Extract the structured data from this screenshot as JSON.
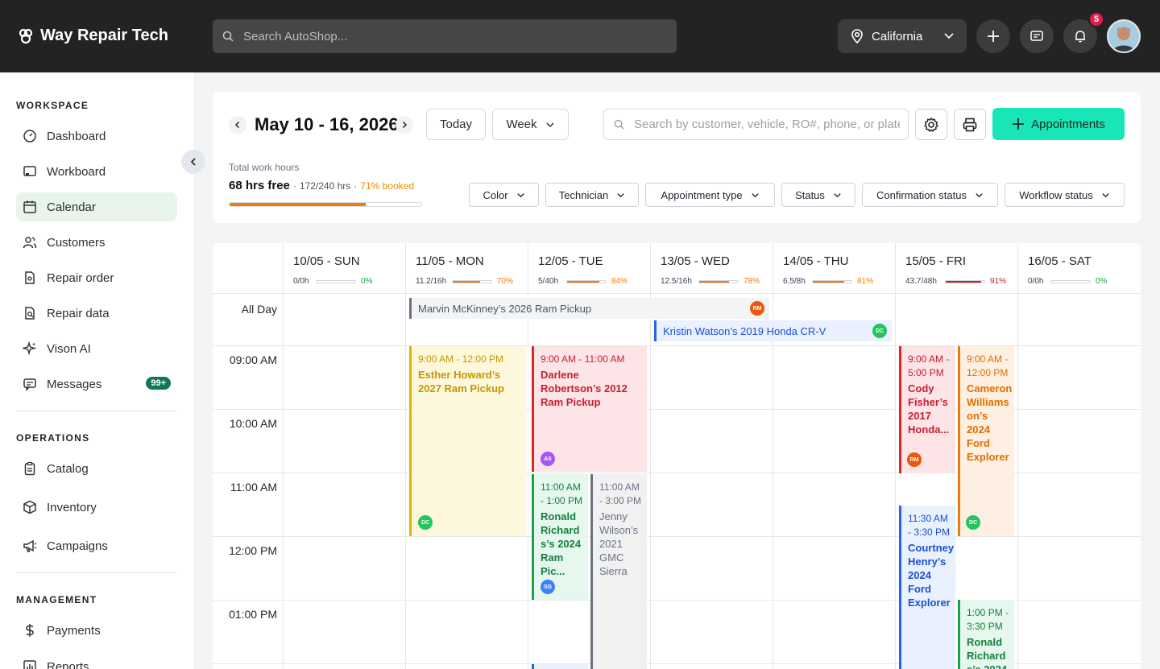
{
  "app": {
    "name": "Way Repair Tech"
  },
  "topbar": {
    "search_placeholder": "Search AutoShop...",
    "location": "California",
    "notification_count": "5"
  },
  "sidebar": {
    "workspace_title": "WORKSPACE",
    "workspace": [
      {
        "label": "Dashboard",
        "icon": "gauge-icon"
      },
      {
        "label": "Workboard",
        "icon": "board-icon"
      },
      {
        "label": "Calendar",
        "icon": "calendar-icon",
        "active": true
      },
      {
        "label": "Customers",
        "icon": "users-icon"
      },
      {
        "label": "Repair order",
        "icon": "document-icon"
      },
      {
        "label": "Repair data",
        "icon": "file-search-icon"
      },
      {
        "label": "Vison AI",
        "icon": "sparkle-icon"
      },
      {
        "label": "Messages",
        "icon": "message-icon",
        "count": "99+"
      }
    ],
    "operations_title": "OPERATIONS",
    "operations": [
      {
        "label": "Catalog",
        "icon": "clipboard-icon"
      },
      {
        "label": "Inventory",
        "icon": "box-icon"
      },
      {
        "label": "Campaigns",
        "icon": "megaphone-icon"
      }
    ],
    "management_title": "MANAGEMENT",
    "management": [
      {
        "label": "Payments",
        "icon": "dollar-icon"
      },
      {
        "label": "Reports",
        "icon": "chart-icon"
      }
    ]
  },
  "header": {
    "date_range": "May 10 - 16, 2026",
    "today_label": "Today",
    "view_label": "Week",
    "search_placeholder": "Search by customer, vehicle, RO#, phone, or plate",
    "appointments_label": "Appointments",
    "total_label": "Total work hours",
    "free_hours": "68 hrs free",
    "booked_hours": "172/240 hrs",
    "booked_pct": "71% booked",
    "booked_fraction": 0.71,
    "filters": [
      "Color",
      "Technician",
      "Appointment type",
      "Status",
      "Confirmation status",
      "Workflow status"
    ]
  },
  "calendar": {
    "days": [
      {
        "name": "10/05 - SUN",
        "hours": "0/0h",
        "pct": "0%",
        "fraction": 0,
        "color": "#16a34a"
      },
      {
        "name": "11/05 - MON",
        "hours": "11.2/16h",
        "pct": "70%",
        "fraction": 0.7,
        "color": "#f07c0a"
      },
      {
        "name": "12/05 - TUE",
        "hours": "5/40h",
        "pct": "84%",
        "fraction": 0.84,
        "color": "#f07c0a"
      },
      {
        "name": "13/05 - WED",
        "hours": "12.5/16h",
        "pct": "78%",
        "fraction": 0.78,
        "color": "#f07c0a"
      },
      {
        "name": "14/05 - THU",
        "hours": "6.5/8h",
        "pct": "81%",
        "fraction": 0.81,
        "color": "#f07c0a"
      },
      {
        "name": "15/05 - FRI",
        "hours": "43.7/48h",
        "pct": "91%",
        "fraction": 0.91,
        "color": "#c81e1e"
      },
      {
        "name": "16/05 - SAT",
        "hours": "0/0h",
        "pct": "0%",
        "fraction": 0,
        "color": "#16a34a"
      }
    ],
    "allday_label": "All Day",
    "times": [
      "09:00 AM",
      "10:00 AM",
      "11:00 AM",
      "12:00 PM",
      "01:00 PM"
    ],
    "allday_events": [
      {
        "title": "Marvin McKinney’s 2026 Ram Pickup",
        "tech": "RM"
      },
      {
        "title": "Kristin Watson’s 2019 Honda CR-V",
        "tech": "DC"
      }
    ],
    "events": [
      {
        "time": "9:00 AM - 12:00 PM",
        "title": "Esther Howard’s 2027 Ram Pickup",
        "tech": "DC"
      },
      {
        "time": "9:00 AM - 11:00 AM",
        "title": "Darlene Robertson’s 2012 Ram Pickup",
        "tech": "AS"
      },
      {
        "time": "11:00 AM - 1:00 PM",
        "title": "Ronald Richard s’s 2024 Ram Pic...",
        "tech": "SG"
      },
      {
        "time": "11:00 AM - 3:00 PM",
        "title": "Jenny Wilson’s 2021 GMC Sierra",
        "tech": ""
      },
      {
        "time": "9:00 AM - 5:00 PM",
        "title": "Cody Fisher’s 2017 Honda...",
        "tech": "RM"
      },
      {
        "time": "9:00 AM - 12:00 PM",
        "title": "Cameron Williams on’s 2024 Ford Explorer",
        "tech": "DC"
      },
      {
        "time": "11:30 AM - 3:30 PM",
        "title": "Courtney Henry’s 2024 Ford Explorer",
        "tech": ""
      },
      {
        "time": "1:00 PM - 3:30 PM",
        "title": "Ronald Richard s’s 2024",
        "tech": ""
      }
    ]
  }
}
